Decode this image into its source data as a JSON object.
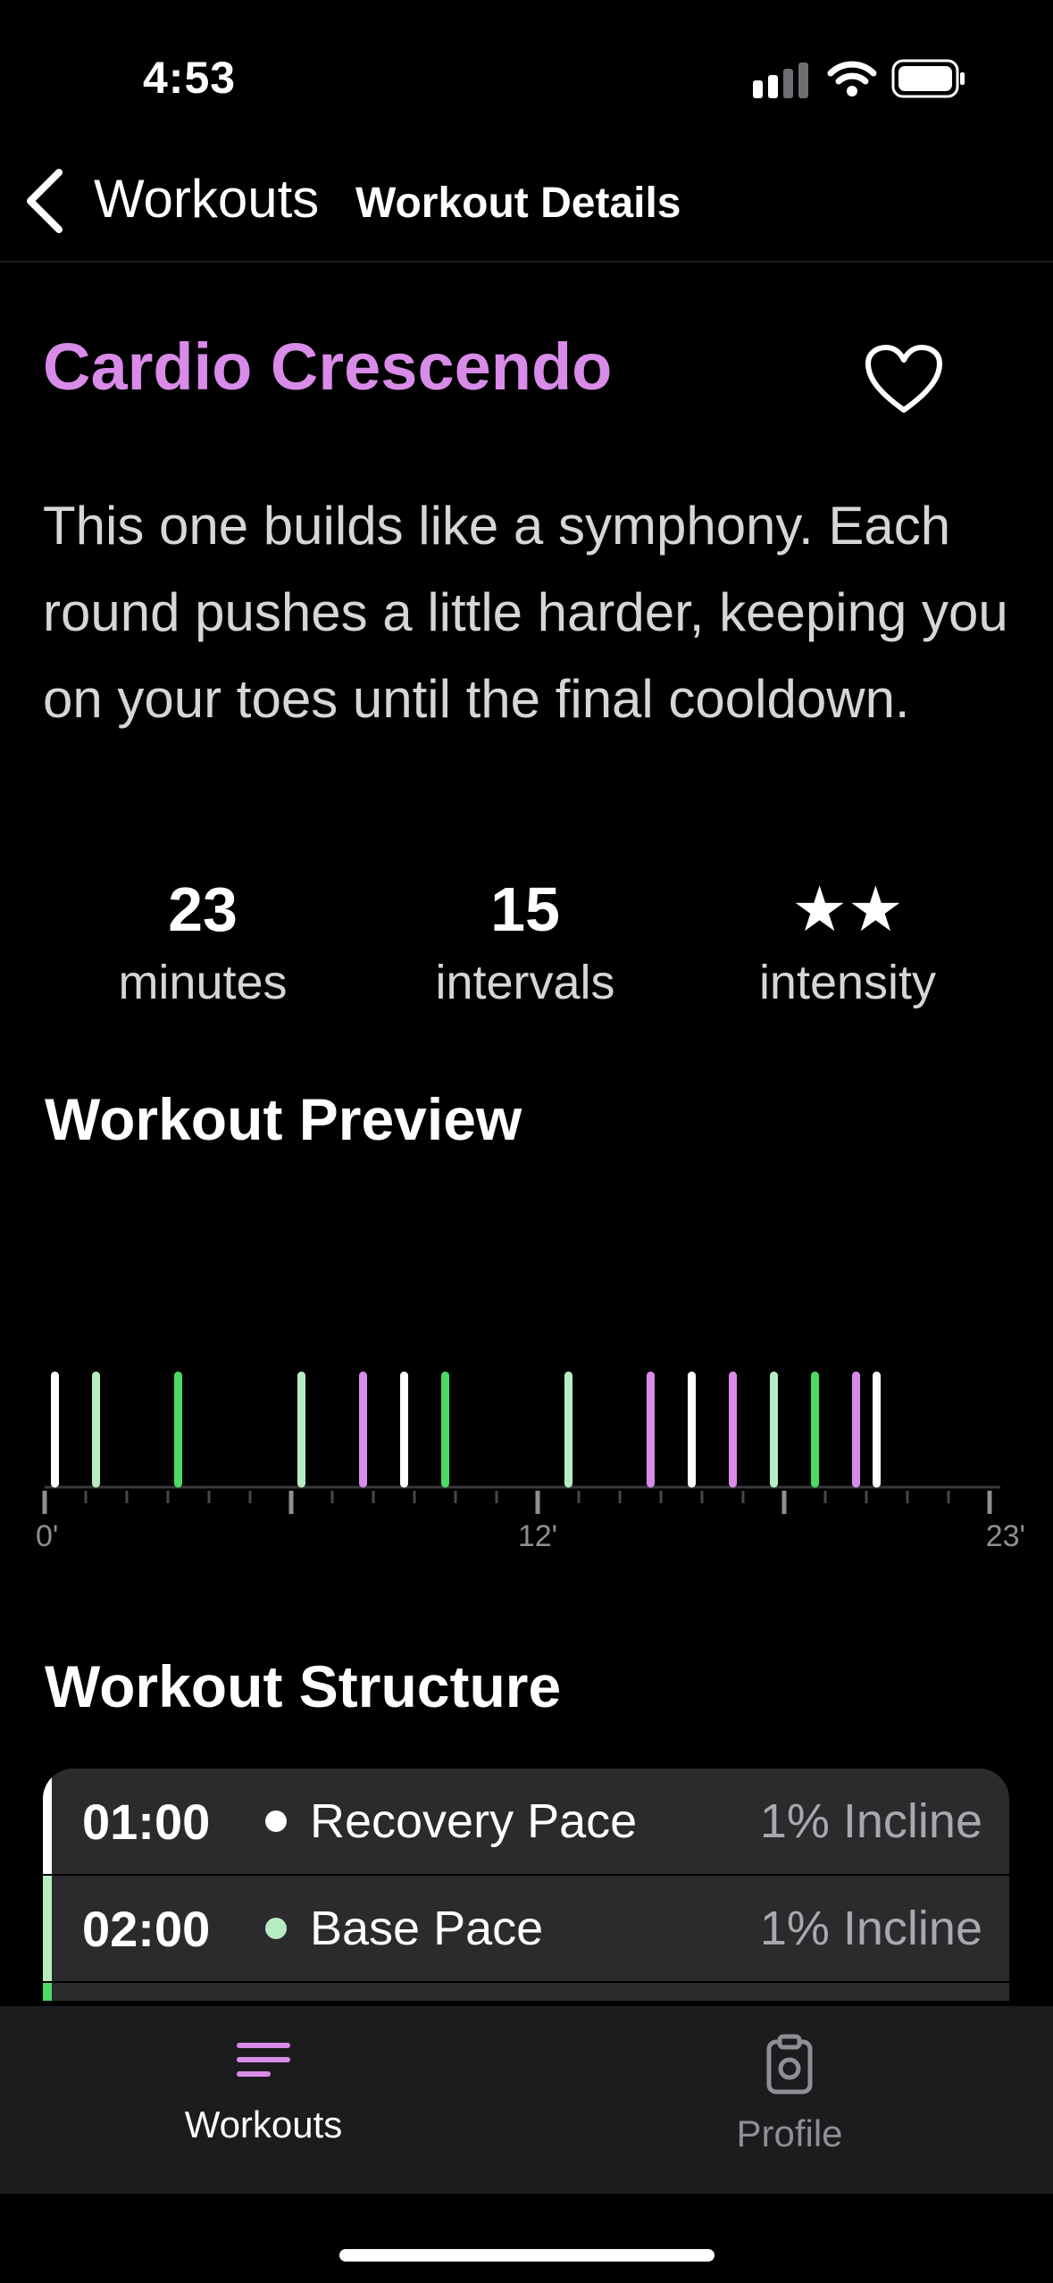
{
  "status_bar": {
    "time": "4:53"
  },
  "nav": {
    "back_label": "Workouts",
    "title": "Workout Details"
  },
  "workout": {
    "title": "Cardio Crescendo",
    "description": "This one builds like a symphony. Each round pushes a little harder, keeping you on your toes until the final cooldown.",
    "stats": [
      {
        "value": "23",
        "label": "minutes"
      },
      {
        "value": "15",
        "label": "intervals"
      },
      {
        "value": "★★",
        "label": "intensity"
      }
    ]
  },
  "colors": {
    "accent": "#d98be8",
    "recovery": "#ffffff",
    "base": "#b6ecc2",
    "push": "#4cd964",
    "peak": "#d98be8"
  },
  "preview": {
    "title": "Workout Preview",
    "chart_data": {
      "type": "bar",
      "x_unit": "minutes",
      "xlim": [
        0,
        23
      ],
      "x_tick_labels": [
        "0'",
        "12'",
        "23'"
      ],
      "x_tick_label_values": [
        0,
        12,
        23
      ],
      "intervals": [
        {
          "minute": 0.25,
          "kind": "recovery"
        },
        {
          "minute": 1.25,
          "kind": "base"
        },
        {
          "minute": 3.25,
          "kind": "push"
        },
        {
          "minute": 6.25,
          "kind": "base"
        },
        {
          "minute": 7.75,
          "kind": "peak"
        },
        {
          "minute": 8.75,
          "kind": "recovery"
        },
        {
          "minute": 9.75,
          "kind": "push"
        },
        {
          "minute": 12.75,
          "kind": "base"
        },
        {
          "minute": 14.75,
          "kind": "peak"
        },
        {
          "minute": 15.75,
          "kind": "recovery"
        },
        {
          "minute": 16.75,
          "kind": "peak"
        },
        {
          "minute": 17.75,
          "kind": "base"
        },
        {
          "minute": 18.75,
          "kind": "push"
        },
        {
          "minute": 19.75,
          "kind": "peak"
        },
        {
          "minute": 20.25,
          "kind": "recovery"
        }
      ]
    }
  },
  "structure": {
    "title": "Workout Structure",
    "rows": [
      {
        "time": "01:00",
        "name": "Recovery Pace",
        "incline": "1% Incline",
        "color": "#ffffff"
      },
      {
        "time": "02:00",
        "name": "Base Pace",
        "incline": "1% Incline",
        "color": "#b6ecc2"
      },
      {
        "time": "",
        "name": "",
        "incline": "",
        "color": "#4cd964"
      }
    ]
  },
  "tabs": [
    {
      "label": "Workouts",
      "icon": "list-icon",
      "active": true
    },
    {
      "label": "Profile",
      "icon": "clipboard-icon",
      "active": false
    }
  ]
}
